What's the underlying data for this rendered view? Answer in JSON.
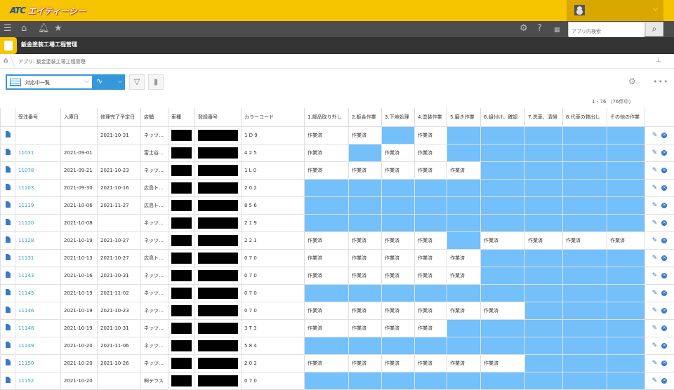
{
  "header": {
    "logo_mark": "ATC",
    "logo_name": "エイティーシー"
  },
  "search": {
    "placeholder": "アプリ内検索"
  },
  "app": {
    "title": "鈑金塗装工場工程管理"
  },
  "breadcrumb": {
    "text": "アプリ: 鈑金塗装工場工程管理"
  },
  "toolbar": {
    "view_label": "対応中一覧"
  },
  "pager": {
    "text": "1 - 76 （76件中）"
  },
  "columns": [
    "受注番号",
    "入庫日",
    "修理完了予定日",
    "店舗",
    "車種",
    "登録番号",
    "カラーコード",
    "1.部品取り外し",
    "2.板金作業",
    "3.下地処理",
    "4.塗装作業",
    "5.磨き作業",
    "6.組付け、確認",
    "7.洗車、清掃",
    "8.代車の貸出し",
    "その他の作業"
  ],
  "status_done_label": "作業済",
  "colors": {
    "accent": "#f7c400",
    "highlight": "#73c0fa",
    "link": "#3498db"
  },
  "rows": [
    {
      "id": "",
      "in": "",
      "due": "2021-10-31",
      "store": "ネッツ…",
      "color": "1 D 9",
      "s": [
        "作業済",
        "作業済",
        "",
        "作業済",
        "",
        "",
        "",
        "",
        ""
      ]
    },
    {
      "id": "11031",
      "in": "2021-09-01",
      "due": "",
      "store": "富士谷…",
      "color": "4 2 5",
      "s": [
        "作業済",
        "",
        "作業済",
        "作業済",
        "",
        "",
        "",
        "",
        ""
      ]
    },
    {
      "id": "11078",
      "in": "2021-09-21",
      "due": "2021-10-23",
      "store": "ネッツ…",
      "color": "1 L 0",
      "s": [
        "作業済",
        "作業済",
        "作業済",
        "作業済",
        "作業済",
        "",
        "",
        "",
        ""
      ]
    },
    {
      "id": "11103",
      "in": "2021-09-30",
      "due": "2021-10-16",
      "store": "広島ト…",
      "color": "2 0 2",
      "s": [
        "",
        "",
        "",
        "",
        "",
        "",
        "",
        "",
        ""
      ]
    },
    {
      "id": "11119",
      "in": "2021-10-06",
      "due": "2021-11-27",
      "store": "広島ト…",
      "color": "8 5 6",
      "s": [
        "",
        "",
        "",
        "",
        "",
        "",
        "",
        "",
        ""
      ]
    },
    {
      "id": "11120",
      "in": "2021-10-08",
      "due": "",
      "store": "ネッツ…",
      "color": "2 1 9",
      "s": [
        "",
        "",
        "",
        "",
        "",
        "",
        "",
        "",
        ""
      ]
    },
    {
      "id": "11128",
      "in": "2021-10-19",
      "due": "2021-10-27",
      "store": "ネッツ…",
      "color": "2 2 1",
      "s": [
        "作業済",
        "作業済",
        "作業済",
        "作業済",
        "",
        "作業済",
        "作業済",
        "作業済",
        "作業済"
      ]
    },
    {
      "id": "11131",
      "in": "2021-10-13",
      "due": "2021-10-27",
      "store": "広島ト…",
      "color": "0 7 0",
      "s": [
        "作業済",
        "作業済",
        "作業済",
        "作業済",
        "作業済",
        "",
        "",
        "",
        ""
      ]
    },
    {
      "id": "11143",
      "in": "2021-10-16",
      "due": "2021-10-31",
      "store": "ネッツ…",
      "color": "0 7 0",
      "s": [
        "作業済",
        "作業済",
        "作業済",
        "作業済",
        "作業済",
        "",
        "",
        "",
        ""
      ]
    },
    {
      "id": "11145",
      "in": "2021-10-19",
      "due": "2021-11-02",
      "store": "ネッツ…",
      "color": "0 7 0",
      "s": [
        "",
        "",
        "",
        "",
        "",
        "",
        "",
        "",
        ""
      ]
    },
    {
      "id": "11146",
      "in": "2021-10-19",
      "due": "2021-10-23",
      "store": "ネッツ…",
      "color": "0 7 0",
      "s": [
        "作業済",
        "作業済",
        "作業済",
        "作業済",
        "作業済",
        "作業済",
        "",
        "",
        ""
      ]
    },
    {
      "id": "11148",
      "in": "2021-10-19",
      "due": "2021-10-31",
      "store": "ネッツ…",
      "color": "3 T 3",
      "s": [
        "作業済",
        "作業済",
        "作業済",
        "作業済",
        "",
        "",
        "",
        "",
        ""
      ]
    },
    {
      "id": "11149",
      "in": "2021-10-20",
      "due": "2021-11-06",
      "store": "ネッツ…",
      "color": "5 8 4",
      "s": [
        "",
        "",
        "",
        "",
        "",
        "",
        "",
        "",
        ""
      ]
    },
    {
      "id": "11150",
      "in": "2021-10-20",
      "due": "2021-10-26",
      "store": "ネッツ…",
      "color": "2 0 2",
      "s": [
        "作業済",
        "作業済",
        "作業済",
        "作業済",
        "作業済",
        "作業済",
        "",
        "",
        ""
      ]
    },
    {
      "id": "11152",
      "in": "2021-10-20",
      "due": "",
      "store": "㈱テラス",
      "color": "0 7 0",
      "s": [
        "",
        "",
        "",
        "",
        "",
        "",
        "",
        "",
        ""
      ]
    }
  ]
}
